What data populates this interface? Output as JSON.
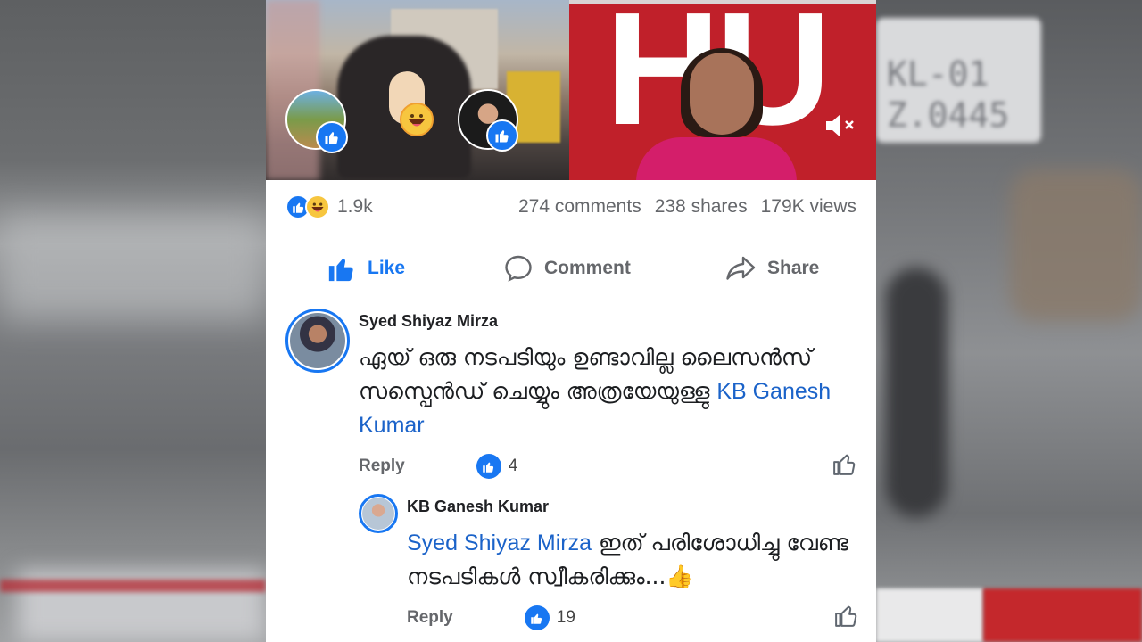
{
  "video": {
    "mute_icon": "speaker-muted-icon",
    "studio_letters": "HU"
  },
  "plate_text": "KL-01\nZ.0445",
  "post": {
    "reaction_count": "1.9k",
    "comments": "274 comments",
    "shares": "238 shares",
    "views": "179K views"
  },
  "actions": {
    "like": "Like",
    "comment": "Comment",
    "share": "Share"
  },
  "comments": [
    {
      "author": "Syed Shiyaz Mirza",
      "text": "ഏയ് ഒരു നടപടിയും ഉണ്ടാവില്ല ലൈസൻസ് സസ്പെൻഡ് ചെയ്യും അത്രയേയുള്ളു",
      "mention": "KB Ganesh Kumar",
      "reply_label": "Reply",
      "like_count": "4"
    },
    {
      "author": "KB Ganesh Kumar",
      "mention": "Syed Shiyaz Mirza",
      "text": "ഇത് പരിശോധിച്ചു വേണ്ട നടപടികൾ സ്വീകരിക്കും...",
      "emoji": "👍",
      "reply_label": "Reply",
      "like_count": "19"
    }
  ],
  "colors": {
    "facebook_blue": "#1877f2",
    "mention_blue": "#1b63c9",
    "muted_text": "#65676b"
  }
}
